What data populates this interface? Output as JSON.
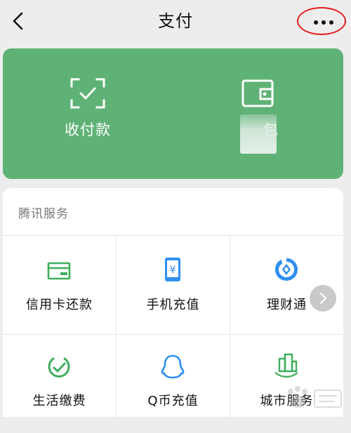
{
  "header": {
    "title": "支付"
  },
  "pay_card": {
    "receive_label": "收付款",
    "wallet_label_visible": "包"
  },
  "services": {
    "title": "腾讯服务",
    "items": [
      {
        "label": "信用卡还款",
        "icon": "credit-card-icon"
      },
      {
        "label": "手机充值",
        "icon": "mobile-topup-icon"
      },
      {
        "label": "理财通",
        "icon": "wealth-icon"
      },
      {
        "label": "生活缴费",
        "icon": "utility-payment-icon"
      },
      {
        "label": "Q币充值",
        "icon": "qq-coin-icon"
      },
      {
        "label": "城市服务",
        "icon": "city-service-icon"
      }
    ]
  },
  "colors": {
    "card_green": "#5fb276",
    "icon_green": "#3fae5c",
    "icon_blue": "#2f8ff0",
    "annotation_red": "#e51d1d"
  }
}
